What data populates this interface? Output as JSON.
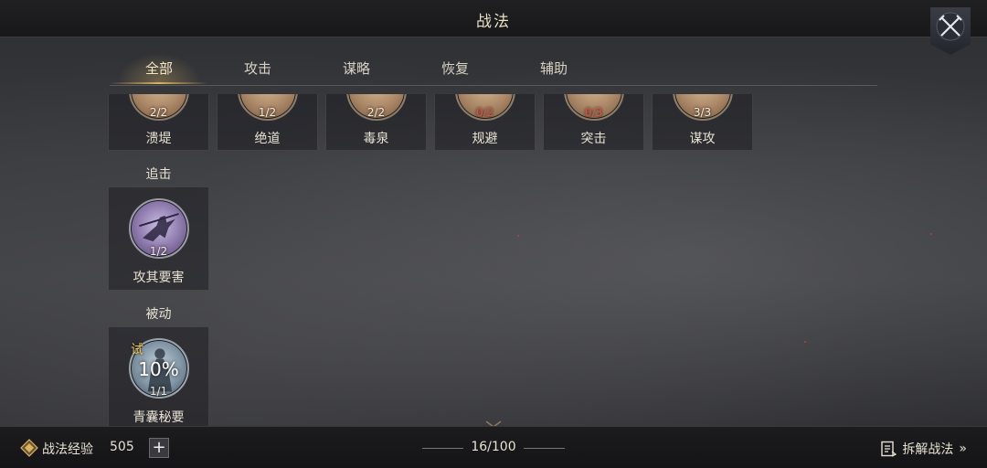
{
  "header": {
    "title": "战法",
    "close_icon": "crossed-swords-icon"
  },
  "tabs": [
    {
      "label": "全部",
      "active": true
    },
    {
      "label": "攻击",
      "active": false
    },
    {
      "label": "谋略",
      "active": false
    },
    {
      "label": "恢复",
      "active": false
    },
    {
      "label": "辅助",
      "active": false
    }
  ],
  "top_row": [
    {
      "name": "溃堤",
      "count": "2/2",
      "count_color": "#f2ead8"
    },
    {
      "name": "绝道",
      "count": "1/2",
      "count_color": "#f2ead8"
    },
    {
      "name": "毒泉",
      "count": "2/2",
      "count_color": "#f2ead8"
    },
    {
      "name": "规避",
      "count": "0/2",
      "count_color": "#e0504a"
    },
    {
      "name": "突击",
      "count": "0/3",
      "count_color": "#e0504a"
    },
    {
      "name": "谋攻",
      "count": "3/3",
      "count_color": "#f2ead8"
    }
  ],
  "sections": [
    {
      "label": "追击",
      "cards": [
        {
          "name": "攻其要害",
          "count": "1/2"
        }
      ]
    },
    {
      "label": "被动",
      "cards": [
        {
          "name": "青囊秘要",
          "count": "1/1",
          "trial_badge": "试",
          "progress": "10%"
        }
      ]
    }
  ],
  "footer": {
    "exp_label": "战法经验",
    "exp_value": "505",
    "exp_icon": "exp-badge-icon",
    "plus_label": "+",
    "page_counter": "16/100",
    "decompose_label": "拆解战法",
    "decompose_chevron": "»",
    "decompose_icon": "document-list-icon"
  },
  "colors": {
    "accent_gold": "#d9b463",
    "count_red": "#e0504a"
  }
}
